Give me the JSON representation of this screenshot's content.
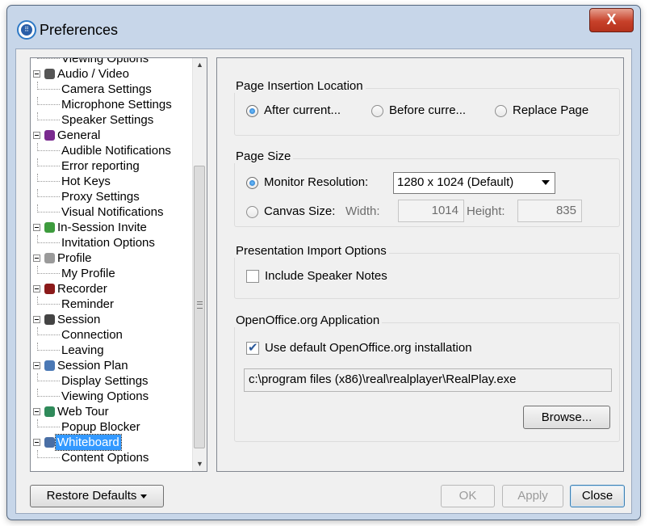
{
  "window": {
    "title": "Preferences",
    "close_glyph": "X",
    "app_icon": "app-logo-icon"
  },
  "tree": {
    "items": [
      {
        "label": "Viewing Options",
        "level": 1
      },
      {
        "label": "Audio / Video",
        "level": 0,
        "icon": "person-camera-icon",
        "color": "#555555"
      },
      {
        "label": "Camera Settings",
        "level": 1
      },
      {
        "label": "Microphone Settings",
        "level": 1
      },
      {
        "label": "Speaker Settings",
        "level": 1
      },
      {
        "label": "General",
        "level": 0,
        "icon": "general-icon",
        "color": "#7a2a8f"
      },
      {
        "label": "Audible Notifications",
        "level": 1
      },
      {
        "label": "Error reporting",
        "level": 1
      },
      {
        "label": "Hot Keys",
        "level": 1
      },
      {
        "label": "Proxy Settings",
        "level": 1
      },
      {
        "label": "Visual Notifications",
        "level": 1
      },
      {
        "label": "In-Session Invite",
        "level": 0,
        "icon": "invite-icon",
        "color": "#3d9b3d"
      },
      {
        "label": "Invitation Options",
        "level": 1
      },
      {
        "label": "Profile",
        "level": 0,
        "icon": "profile-icon",
        "color": "#9a9a9a"
      },
      {
        "label": "My Profile",
        "level": 1
      },
      {
        "label": "Recorder",
        "level": 0,
        "icon": "recorder-icon",
        "color": "#8b1a1a"
      },
      {
        "label": "Reminder",
        "level": 1
      },
      {
        "label": "Session",
        "level": 0,
        "icon": "session-icon",
        "color": "#444444"
      },
      {
        "label": "Connection",
        "level": 1
      },
      {
        "label": "Leaving",
        "level": 1
      },
      {
        "label": "Session Plan",
        "level": 0,
        "icon": "session-plan-icon",
        "color": "#4a78b5"
      },
      {
        "label": "Display Settings",
        "level": 1
      },
      {
        "label": "Viewing Options",
        "level": 1
      },
      {
        "label": "Web Tour",
        "level": 0,
        "icon": "globe-icon",
        "color": "#2f8a5a"
      },
      {
        "label": "Popup Blocker",
        "level": 1
      },
      {
        "label": "Whiteboard",
        "level": 0,
        "icon": "pen-icon",
        "color": "#4a6fa5",
        "selected": true
      },
      {
        "label": "Content Options",
        "level": 1
      }
    ]
  },
  "page_insertion": {
    "title": "Page Insertion Location",
    "options": [
      "After current...",
      "Before curre...",
      "Replace Page"
    ],
    "selected": 0
  },
  "page_size": {
    "title": "Page Size",
    "monitor_label": "Monitor Resolution:",
    "monitor_value": "1280 x 1024 (Default)",
    "canvas_label": "Canvas Size:",
    "width_label": "Width:",
    "width_value": "1014",
    "height_label": "Height:",
    "height_value": "835",
    "selected": "monitor"
  },
  "import": {
    "title": "Presentation Import Options",
    "speaker_notes_label": "Include Speaker Notes",
    "speaker_notes_checked": false
  },
  "openoffice": {
    "title": "OpenOffice.org Application",
    "use_default_label": "Use default OpenOffice.org installation",
    "use_default_checked": true,
    "path": "c:\\program files (x86)\\real\\realplayer\\RealPlay.exe",
    "browse_label": "Browse..."
  },
  "footer": {
    "restore_label": "Restore Defaults",
    "ok_label": "OK",
    "apply_label": "Apply",
    "close_label": "Close"
  }
}
